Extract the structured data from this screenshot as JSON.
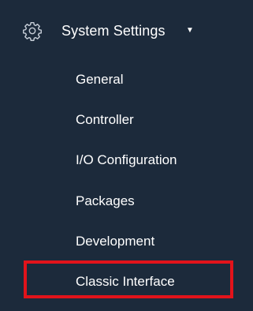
{
  "menu": {
    "title": "System Settings",
    "icon": "gear-icon",
    "caret": "▼",
    "items": [
      {
        "label": "General"
      },
      {
        "label": "Controller"
      },
      {
        "label": "I/O Configuration"
      },
      {
        "label": "Packages"
      },
      {
        "label": "Development"
      },
      {
        "label": "Classic Interface"
      }
    ]
  },
  "colors": {
    "background": "#1c2a3b",
    "text": "#ffffff",
    "highlight_border": "#e2131b"
  }
}
